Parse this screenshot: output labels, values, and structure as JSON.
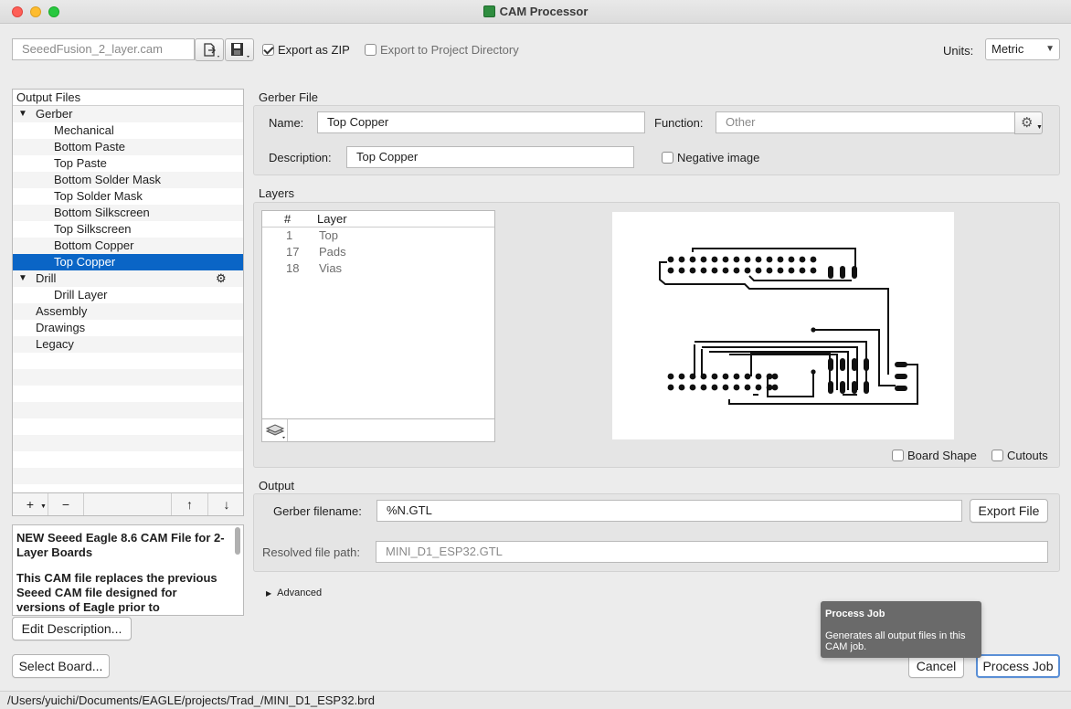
{
  "window": {
    "title": "CAM Processor"
  },
  "toolbar": {
    "cam_file": "SeeedFusion_2_layer.cam",
    "export_zip_label": "Export as ZIP",
    "export_zip_checked": true,
    "export_project_label": "Export to Project Directory",
    "export_project_checked": false,
    "units_label": "Units:",
    "units_value": "Metric"
  },
  "output_files": {
    "header": "Output Files",
    "items": [
      {
        "label": "Gerber",
        "level": 0,
        "expanded": true
      },
      {
        "label": "Mechanical",
        "level": 1
      },
      {
        "label": "Bottom Paste",
        "level": 1
      },
      {
        "label": "Top Paste",
        "level": 1
      },
      {
        "label": "Bottom Solder Mask",
        "level": 1
      },
      {
        "label": "Top Solder Mask",
        "level": 1
      },
      {
        "label": "Bottom Silkscreen",
        "level": 1
      },
      {
        "label": "Top Silkscreen",
        "level": 1
      },
      {
        "label": "Bottom Copper",
        "level": 1
      },
      {
        "label": "Top Copper",
        "level": 1,
        "selected": true
      },
      {
        "label": "Drill",
        "level": 0,
        "expanded": true
      },
      {
        "label": "Drill Layer",
        "level": 1
      },
      {
        "label": "Assembly",
        "level": 0
      },
      {
        "label": "Drawings",
        "level": 0
      },
      {
        "label": "Legacy",
        "level": 0
      }
    ],
    "tools": {
      "add": "+",
      "remove": "−",
      "up": "↑",
      "down": "↓"
    }
  },
  "description_box": {
    "para1": "NEW Seeed Eagle 8.6 CAM File for 2-Layer Boards",
    "para2": "This CAM file replaces the previous Seeed CAM file designed for versions of Eagle prior to"
  },
  "buttons": {
    "edit_description": "Edit Description...",
    "select_board": "Select Board...",
    "export_file": "Export File",
    "cancel": "Cancel",
    "process_job": "Process Job"
  },
  "gerber_file": {
    "section": "Gerber File",
    "name_label": "Name:",
    "name_value": "Top Copper",
    "function_label": "Function:",
    "function_placeholder": "Other",
    "description_label": "Description:",
    "description_value": "Top Copper",
    "negative_label": "Negative image",
    "negative_checked": false
  },
  "layers": {
    "section": "Layers",
    "col_num": "#",
    "col_layer": "Layer",
    "rows": [
      {
        "num": "1",
        "name": "Top"
      },
      {
        "num": "17",
        "name": "Pads"
      },
      {
        "num": "18",
        "name": "Vias"
      }
    ],
    "board_shape_label": "Board Shape",
    "cutouts_label": "Cutouts"
  },
  "output": {
    "section": "Output",
    "gerber_filename_label": "Gerber filename:",
    "gerber_filename_value": "%N.GTL",
    "resolved_label": "Resolved file path:",
    "resolved_value": "MINI_D1_ESP32.GTL",
    "advanced_label": "Advanced"
  },
  "tooltip": {
    "title": "Process Job",
    "text": "Generates all output files in this CAM job."
  },
  "status": {
    "path": "/Users/yuichi/Documents/EAGLE/projects/Trad_/MINI_D1_ESP32.brd"
  },
  "colors": {
    "selection": "#0a65c6",
    "accent_border": "#5a8fd6"
  }
}
